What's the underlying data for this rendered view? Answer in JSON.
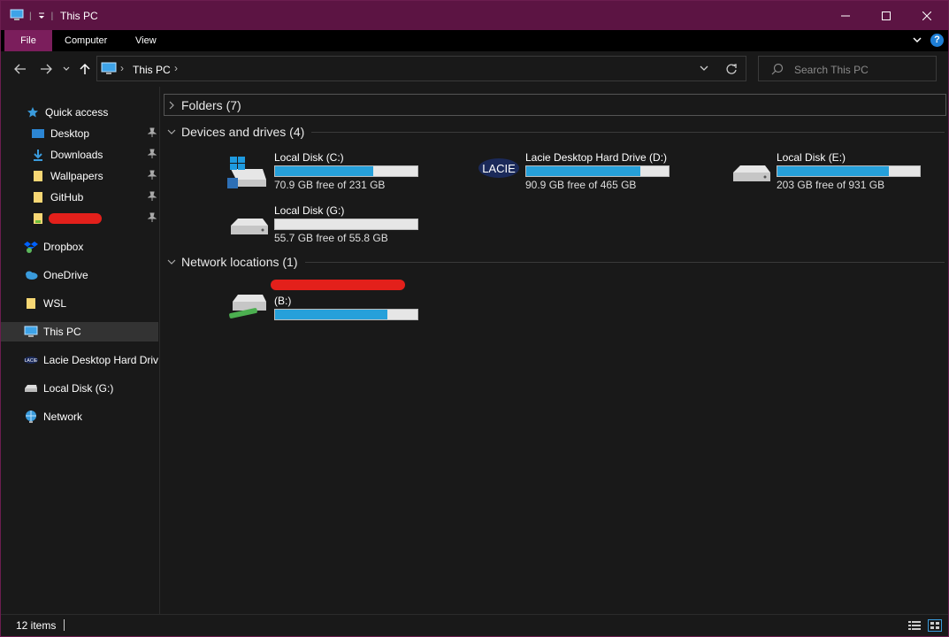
{
  "window": {
    "title": "This PC"
  },
  "ribbon": {
    "tabs": [
      "File",
      "Computer",
      "View"
    ]
  },
  "address": {
    "crumb": "This PC",
    "search_placeholder": "Search This PC"
  },
  "sidebar": {
    "items": [
      {
        "label": "Quick access"
      },
      {
        "label": "Desktop"
      },
      {
        "label": "Downloads"
      },
      {
        "label": "Wallpapers"
      },
      {
        "label": "GitHub"
      },
      {
        "label": ""
      },
      {
        "label": "Dropbox"
      },
      {
        "label": "OneDrive"
      },
      {
        "label": "WSL"
      },
      {
        "label": "This PC"
      },
      {
        "label": "Lacie Desktop Hard Drive"
      },
      {
        "label": "Local Disk (G:)"
      },
      {
        "label": "Network"
      }
    ]
  },
  "content": {
    "folders_label": "Folders (7)",
    "devices_label": "Devices and drives (4)",
    "network_label": "Network locations (1)",
    "drives": [
      {
        "name": "Local Disk (C:)",
        "free": "70.9 GB free of 231 GB",
        "used_fraction": 0.69,
        "icon": "windows-drive-icon"
      },
      {
        "name": "Lacie Desktop Hard Drive (D:)",
        "free": "90.9 GB free of 465 GB",
        "used_fraction": 0.8,
        "icon": "lacie-drive-icon"
      },
      {
        "name": "Local Disk (E:)",
        "free": "203 GB free of 931 GB",
        "used_fraction": 0.78,
        "icon": "hard-drive-icon"
      },
      {
        "name": "Local Disk (G:)",
        "free": "55.7 GB free of 55.8 GB",
        "used_fraction": 0.0,
        "icon": "hard-drive-icon"
      }
    ],
    "network": [
      {
        "name": "(B:)",
        "used_fraction": 0.79,
        "icon": "network-drive-icon"
      }
    ]
  },
  "status": {
    "items_count": "12 items"
  },
  "colors": {
    "accent": "#5c1443",
    "file_tab": "#7b1e5c",
    "bar_fill": "#26a0da"
  }
}
